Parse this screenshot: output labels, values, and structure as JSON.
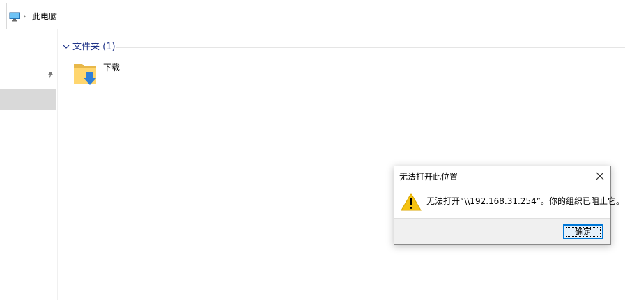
{
  "address_bar": {
    "pc_icon": "computer-icon",
    "separator": "›",
    "location": "此电脑"
  },
  "nav_pane": {
    "pin_icon": "pin-icon"
  },
  "content": {
    "group": {
      "title": "文件夹 (1)",
      "chevron": "chevron-down-icon"
    },
    "items": [
      {
        "label": "下载",
        "icon": "downloads-folder-icon"
      }
    ]
  },
  "dialog": {
    "title": "无法打开此位置",
    "message": "无法打开“\\\\192.168.31.254”。你的组织已阻止它。",
    "ok_label": "确定",
    "icon": "warning-icon",
    "close_icon": "close-icon"
  },
  "colors": {
    "accent": "#0078d7",
    "group_title": "#1e3287",
    "warning": "#f5c211"
  }
}
